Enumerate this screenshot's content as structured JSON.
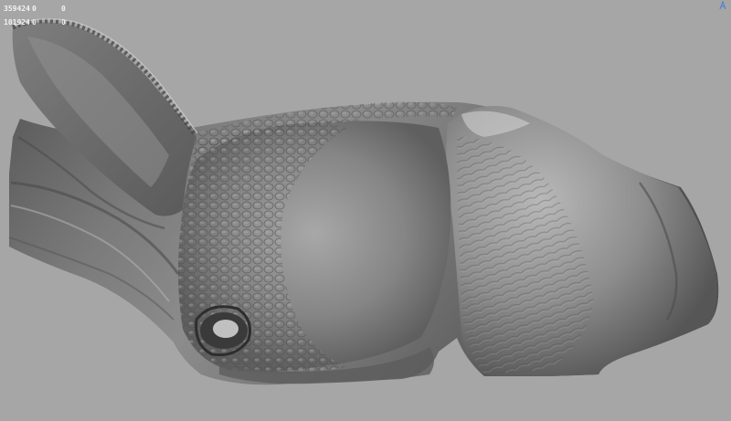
{
  "stats": {
    "rows": [
      {
        "a": "359424",
        "b": "0",
        "c": "0"
      },
      {
        "a": "101924",
        "b": "0",
        "c": "0"
      }
    ]
  },
  "colors": {
    "background": "#a6a6a6",
    "mesh_light": "#c9c9c9",
    "mesh_mid": "#8e8e8e",
    "mesh_dark": "#404040",
    "overlay_text": "#f2f2f2",
    "corner_mark": "#5d84c8"
  },
  "icons": {
    "corner": "view-axis-icon"
  }
}
